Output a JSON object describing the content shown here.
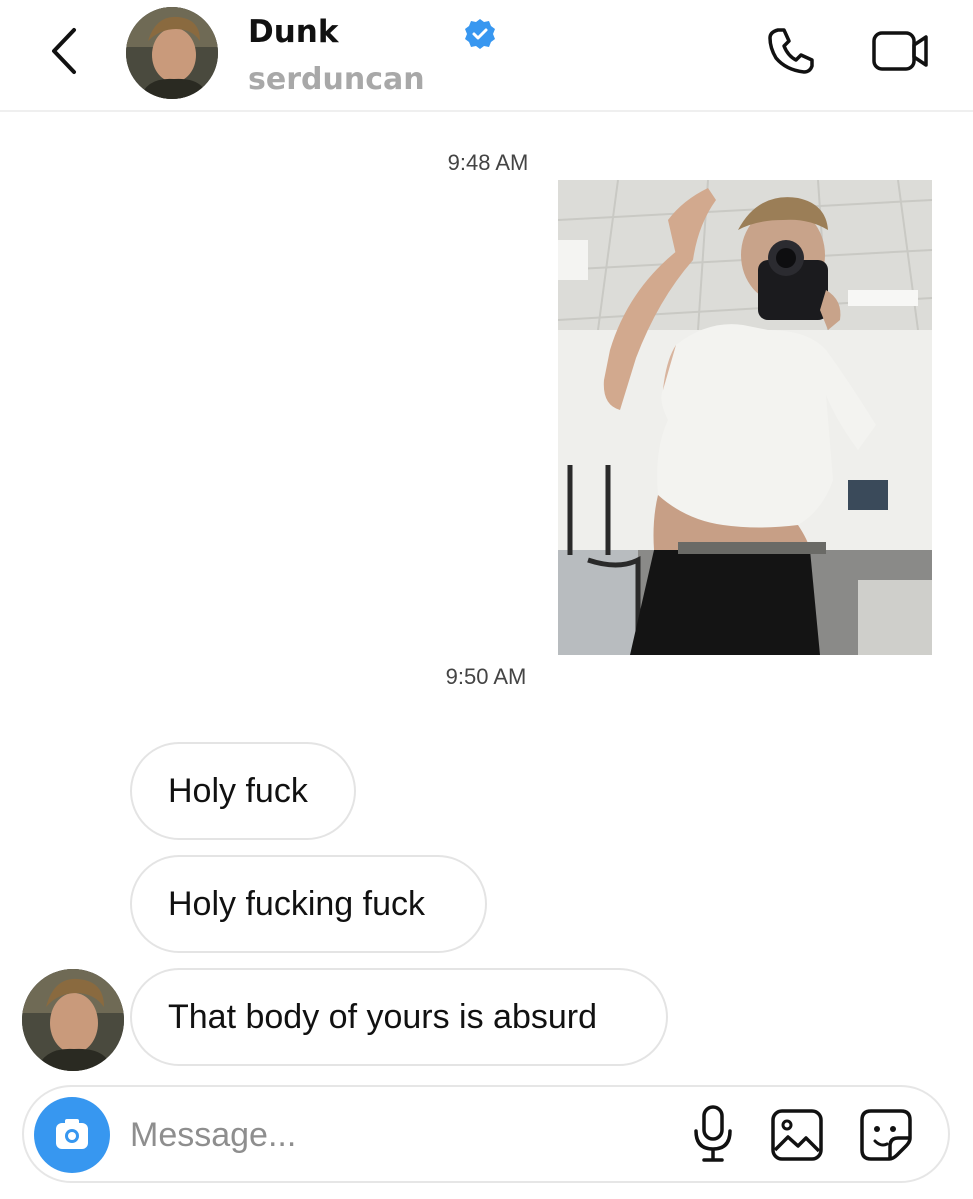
{
  "header": {
    "name": "Dunk",
    "username": "serduncan",
    "icons": {
      "back": "chevron-left-icon",
      "verified": "verified-badge-icon",
      "call": "phone-icon",
      "video": "video-camera-icon"
    },
    "colors": {
      "verified": "#3897f0",
      "username": "#a8a8a8"
    }
  },
  "thread": {
    "timestamps": [
      "9:48 AM",
      "9:50 AM"
    ],
    "photo": {
      "kind": "sent-photo"
    },
    "messages": [
      {
        "text": "Holy fuck"
      },
      {
        "text": "Holy fucking fuck"
      },
      {
        "text": "That body of yours is absurd"
      }
    ]
  },
  "composer": {
    "placeholder": "Message...",
    "value": "",
    "icons": [
      "camera-icon",
      "microphone-icon",
      "gallery-icon",
      "sticker-icon"
    ],
    "colors": {
      "camera": "#3797f0"
    }
  }
}
